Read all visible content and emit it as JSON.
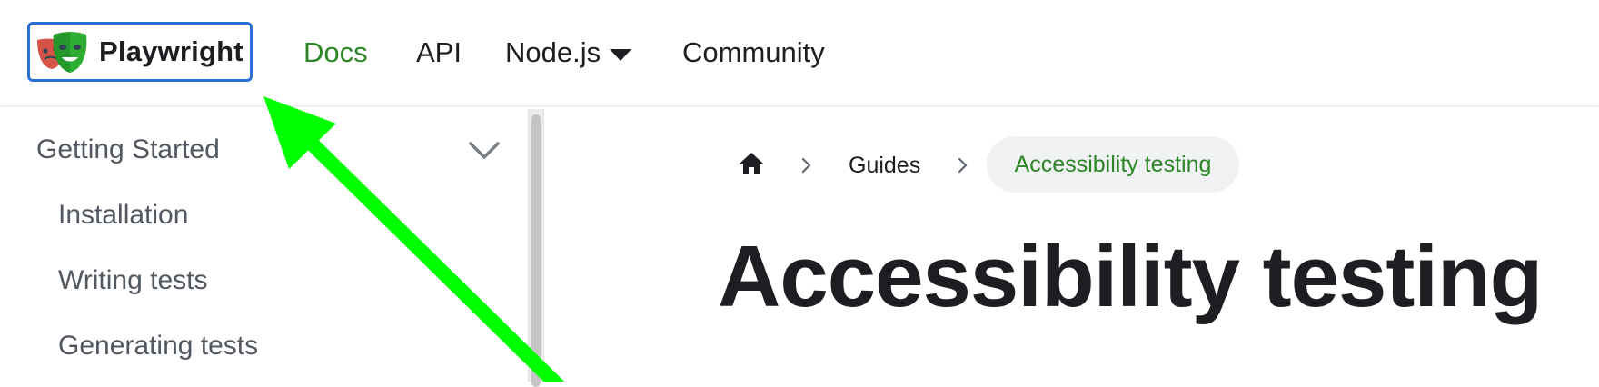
{
  "navbar": {
    "brand_title": "Playwright",
    "links": {
      "docs": "Docs",
      "api": "API",
      "language": "Node.js",
      "community": "Community"
    },
    "active_color": "#2e8527"
  },
  "sidebar": {
    "category": "Getting Started",
    "items": [
      "Installation",
      "Writing tests",
      "Generating tests"
    ]
  },
  "breadcrumb": {
    "items": [
      "Guides",
      "Accessibility testing"
    ]
  },
  "page": {
    "title": "Accessibility testing"
  },
  "annotation": {
    "arrow_color": "#00ff00",
    "highlight_color": "#2a6fd6"
  }
}
